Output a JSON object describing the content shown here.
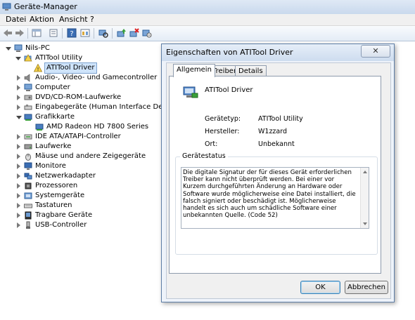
{
  "window": {
    "title": "Geräte-Manager",
    "menu": [
      "Datei",
      "Aktion",
      "Ansicht",
      "?"
    ]
  },
  "toolbar": {
    "icons": [
      "back-arrow-icon",
      "forward-arrow-icon",
      "show-hide-tree-icon",
      "properties-icon",
      "help-icon",
      "view-icon",
      "scan-hardware-icon",
      "update-driver-icon",
      "uninstall-icon",
      "disable-icon"
    ]
  },
  "tree": {
    "root": "Nils-PC",
    "atitool_category": "ATITool Utility",
    "atitool_driver": "ATITool Driver",
    "categories": [
      "Audio-, Video- und Gamecontroller",
      "Computer",
      "DVD/CD-ROM-Laufwerke",
      "Eingabegeräte (Human Interface Devices)",
      "Grafikkarte",
      "IDE ATA/ATAPI-Controller",
      "Laufwerke",
      "Mäuse und andere Zeigegeräte",
      "Monitore",
      "Netzwerkadapter",
      "Prozessoren",
      "Systemgeräte",
      "Tastaturen",
      "Tragbare Geräte",
      "USB-Controller"
    ],
    "graphics_device": "AMD Radeon HD 7800 Series"
  },
  "dialog": {
    "title": "Eigenschaften von ATITool Driver",
    "close_label": "✕",
    "tabs": [
      "Allgemein",
      "Treiber",
      "Details"
    ],
    "device_name": "ATITool Driver",
    "properties": [
      {
        "label": "Gerätetyp:",
        "value": "ATITool Utility"
      },
      {
        "label": "Hersteller:",
        "value": "W1zzard"
      },
      {
        "label": "Ort:",
        "value": "Unbekannt"
      }
    ],
    "status_legend": "Gerätestatus",
    "status_text": "Die digitale Signatur der für dieses Gerät erforderlichen Treiber kann nicht überprüft werden. Bei einer vor Kurzem durchgeführten Änderung an Hardware oder Software wurde möglicherweise eine Datei installiert, die falsch signiert oder beschädigt ist. Möglicherweise handelt es sich auch um schädliche Software einer unbekannten Quelle. (Code 52)",
    "ok_label": "OK",
    "cancel_label": "Abbrechen"
  }
}
